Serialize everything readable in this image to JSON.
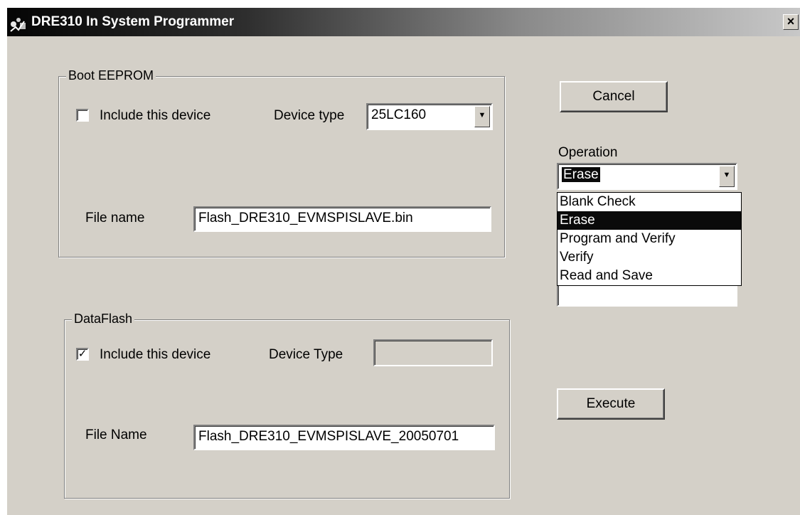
{
  "window": {
    "title": "DRE310 In System Programmer",
    "close_glyph": "×"
  },
  "boot_eeprom": {
    "legend": "Boot EEPROM",
    "include_label": "Include this device",
    "include_checked": false,
    "device_type_label": "Device type",
    "device_type_value": "25LC160",
    "file_label": "File name",
    "file_value": "Flash_DRE310_EVMSPISLAVE.bin"
  },
  "dataflash": {
    "legend": "DataFlash",
    "include_label": "Include this device",
    "include_checked": true,
    "check_glyph": "✓",
    "device_type_label": "Device Type",
    "device_type_value": "",
    "file_label": "File Name",
    "file_value": "Flash_DRE310_EVMSPISLAVE_20050701"
  },
  "actions": {
    "cancel_label": "Cancel",
    "execute_label": "Execute"
  },
  "operation": {
    "label": "Operation",
    "selected": "Erase",
    "arrow_glyph": "▼",
    "options": [
      "Blank Check",
      "Erase",
      "Program and Verify",
      "Verify",
      "Read and Save"
    ]
  }
}
